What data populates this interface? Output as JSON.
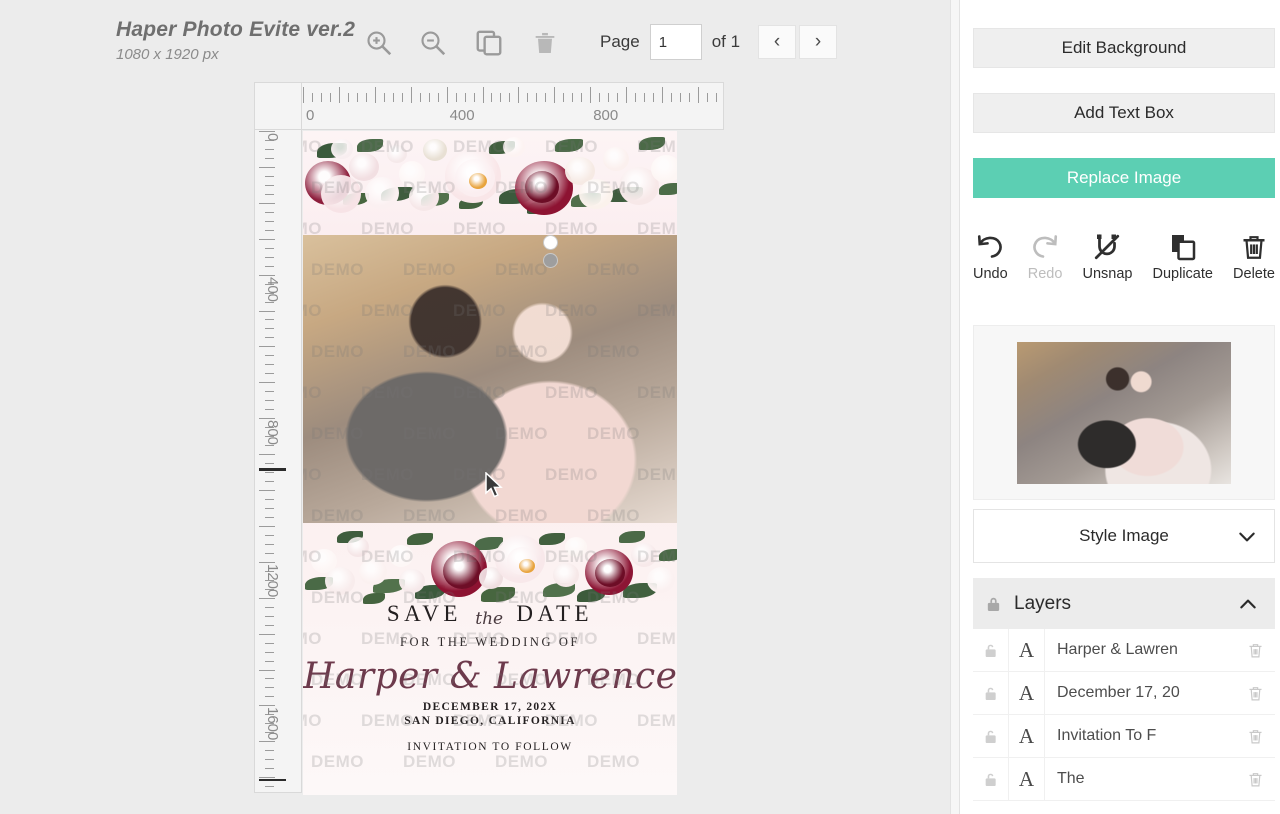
{
  "toolbar": {
    "doc_title": "Haper Photo Evite ver.2",
    "doc_dimensions": "1080 x 1920 px",
    "zoom_in_icon": "zoom-in-icon",
    "zoom_out_icon": "zoom-out-icon",
    "duplicate_page_icon": "duplicate-page-icon",
    "delete_page_icon": "trash-icon",
    "page_label": "Page",
    "page_value": "1",
    "of_label": "of 1",
    "prev_label": "‹",
    "next_label": "›"
  },
  "rulers": {
    "horizontal_ticks": [
      "0",
      "400",
      "800"
    ],
    "vertical_ticks": [
      "0",
      "400",
      "800",
      "1200",
      "1600"
    ],
    "unit": "px"
  },
  "canvas": {
    "watermark_text": "DEMO",
    "card": {
      "save_the_date_left": "SAVE",
      "save_the_date_script": "the",
      "save_the_date_right": "DATE",
      "for_the_wedding_of": "FOR THE WEDDING OF",
      "names": "Harper & Lawrence",
      "date": "DECEMBER 17, 202X",
      "city": "SAN DIEGO, CALIFORNIA",
      "invitation": "INVITATION TO FOLLOW"
    }
  },
  "panel": {
    "edit_background_label": "Edit Background",
    "add_text_box_label": "Add Text Box",
    "replace_image_label": "Replace Image",
    "replace_image_color": "#5ccfb3",
    "tools": [
      {
        "label": "Undo",
        "icon": "undo-icon",
        "disabled": false
      },
      {
        "label": "Redo",
        "icon": "redo-icon",
        "disabled": true
      },
      {
        "label": "Unsnap",
        "icon": "unsnap-icon",
        "disabled": false
      },
      {
        "label": "Duplicate",
        "icon": "duplicate-icon",
        "disabled": false
      },
      {
        "label": "Delete",
        "icon": "trash-icon",
        "disabled": false
      }
    ],
    "style_image_label": "Style Image",
    "style_image_chevron": "chevron-down-icon",
    "layers_title": "Layers",
    "layers_lock_icon": "lock-closed-icon",
    "layers_chevron": "chevron-up-icon",
    "layers": [
      {
        "type": "A",
        "name": "Harper & Lawren",
        "lock_icon": "lock-open-icon",
        "delete_icon": "trash-icon"
      },
      {
        "type": "A",
        "name": "December 17, 20",
        "lock_icon": "lock-open-icon",
        "delete_icon": "trash-icon"
      },
      {
        "type": "A",
        "name": "Invitation To F",
        "lock_icon": "lock-open-icon",
        "delete_icon": "trash-icon"
      },
      {
        "type": "A",
        "name": "The",
        "lock_icon": "lock-open-icon",
        "delete_icon": "trash-icon"
      }
    ]
  }
}
